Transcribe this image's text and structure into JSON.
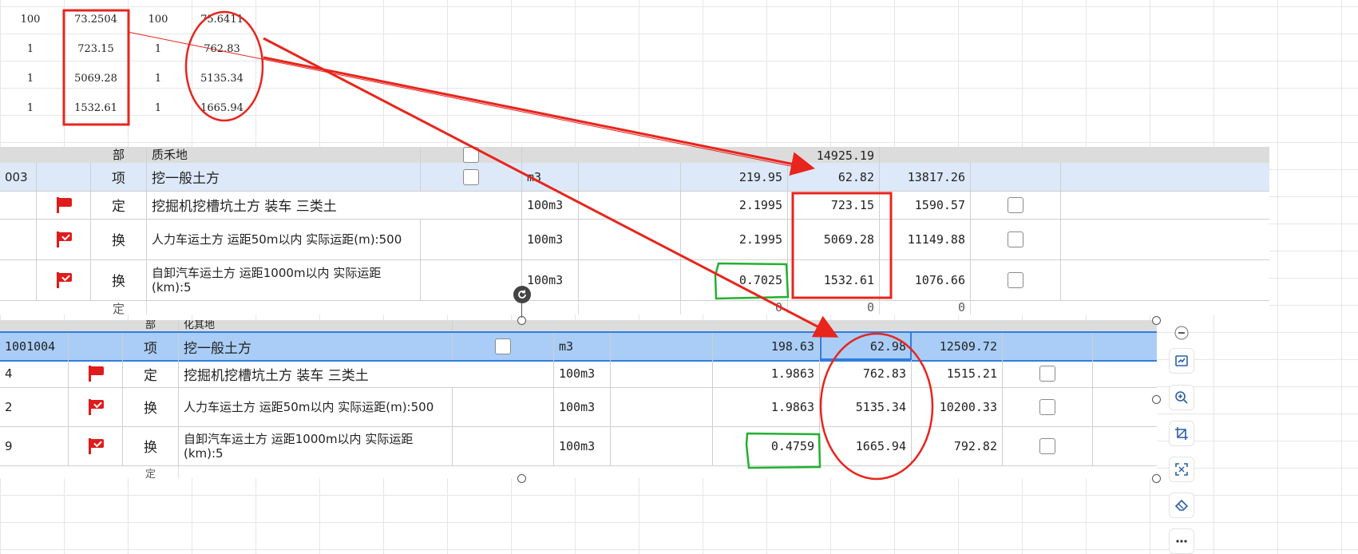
{
  "top_grid": {
    "rows": [
      [
        "100",
        "73.2504",
        "100",
        "75.6411"
      ],
      [
        "1",
        "723.15",
        "1",
        "762.83"
      ],
      [
        "1",
        "5069.28",
        "1",
        "5135.34"
      ],
      [
        "1",
        "1532.61",
        "1",
        "1665.94"
      ]
    ]
  },
  "table1": {
    "header_partial": {
      "type": "部",
      "name": "质禾地",
      "total": "14925.19"
    },
    "rows": [
      {
        "code": "003",
        "type": "项",
        "name": "挖一般土方",
        "unit": "m3",
        "qty": "219.95",
        "price": "62.82",
        "total": "13817.26"
      },
      {
        "code": "",
        "type": "定",
        "name": "挖掘机挖槽坑土方 装车 三类土",
        "unit": "100m3",
        "qty": "2.1995",
        "price": "723.15",
        "total": "1590.57"
      },
      {
        "code": "",
        "type": "换",
        "name": "人力车运土方 运距50m以内  实际运距(m):500",
        "unit": "100m3",
        "qty": "2.1995",
        "price": "5069.28",
        "total": "11149.88"
      },
      {
        "code": "",
        "type": "换",
        "name": "自卸汽车运土方 运距1000m以内  实际运距(km):5",
        "unit": "100m3",
        "qty": "0.7025",
        "price": "1532.61",
        "total": "1076.66"
      }
    ],
    "trailing_partial": {
      "type": "定",
      "qty": "0",
      "price": "0",
      "total": "0"
    }
  },
  "table2": {
    "header_partial": {
      "type": "部",
      "name": "化其地"
    },
    "rows": [
      {
        "code": "1001004",
        "type": "项",
        "name": "挖一般土方",
        "unit": "m3",
        "qty": "198.63",
        "price": "62.98",
        "total": "12509.72"
      },
      {
        "code": "4",
        "type": "定",
        "name": "挖掘机挖槽坑土方 装车 三类土",
        "unit": "100m3",
        "qty": "1.9863",
        "price": "762.83",
        "total": "1515.21"
      },
      {
        "code": "2",
        "type": "换",
        "name": "人力车运土方 运距50m以内  实际运距(m):500",
        "unit": "100m3",
        "qty": "1.9863",
        "price": "5135.34",
        "total": "10200.33"
      },
      {
        "code": "9",
        "type": "换",
        "name": "自卸汽车运土方 运距1000m以内  实际运距(km):5",
        "unit": "100m3",
        "qty": "0.4759",
        "price": "1665.94",
        "total": "792.82"
      }
    ],
    "trailing_partial": {
      "type": "定"
    }
  },
  "toolbar": {
    "icons": [
      "minus-icon",
      "image-edit-icon",
      "zoom-in-icon",
      "crop-icon",
      "ocr-icon",
      "eraser-icon",
      "more-icon"
    ]
  },
  "colors": {
    "annotation_red": "#e8241c",
    "annotation_green": "#22b02f",
    "selection_blue": "#2f7de1",
    "row_highlight": "#a9cdf6",
    "flag_red": "#e01b1b"
  }
}
